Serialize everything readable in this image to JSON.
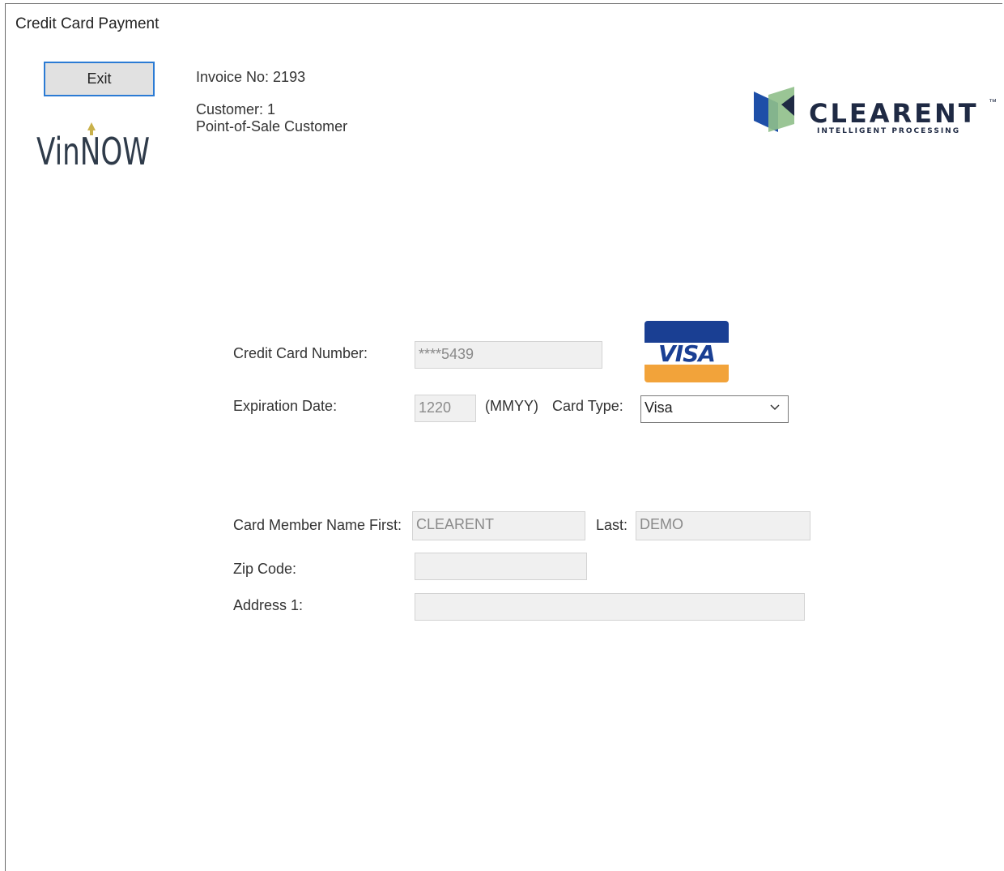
{
  "window": {
    "title": "Credit Card Payment"
  },
  "toolbar": {
    "exit_label": "Exit"
  },
  "invoice": {
    "number_text": "Invoice No: 2193",
    "customer_text": "Customer: 1",
    "customer_name": "Point-of-Sale Customer"
  },
  "logos": {
    "vinnow_text": "VinNOW",
    "clearent_text": "CLEARENT",
    "clearent_tm": "™",
    "clearent_tagline": "INTELLIGENT PROCESSING",
    "visa_text": "VISA"
  },
  "form": {
    "card_number_label": "Credit Card Number:",
    "card_number_value": "****5439",
    "expiration_label": "Expiration Date:",
    "expiration_value": "1220",
    "expiration_format": "(MMYY)",
    "card_type_label": "Card Type:",
    "card_type_value": "Visa",
    "name_first_label": "Card Member Name First:",
    "name_first_value": "CLEARENT",
    "name_last_label": "Last:",
    "name_last_value": "DEMO",
    "zip_label": "Zip Code:",
    "zip_value": "",
    "address_label": "Address 1:",
    "address_value": ""
  },
  "colors": {
    "accent_border": "#2b7bd4",
    "visa_blue": "#1a3f93",
    "visa_gold": "#f2a33a",
    "clearent_navy": "#1f2a44",
    "clearent_green": "#8fbf8a",
    "clearent_blue": "#1e4fa8"
  }
}
